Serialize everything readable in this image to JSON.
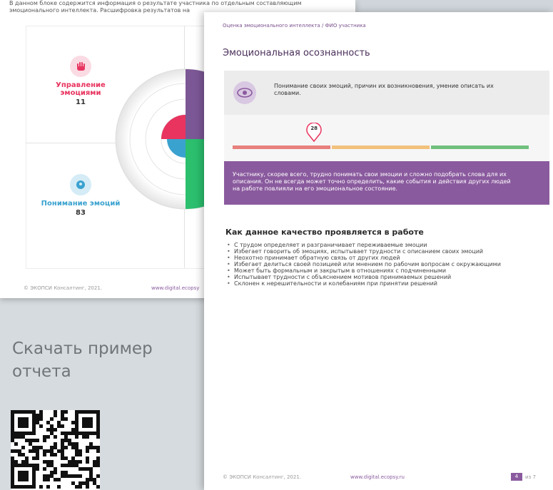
{
  "back_page": {
    "intro": "В данном блоке содержится информация о результате участника по отдельным составляющим эмоционального интеллекта. Расшифровка результатов на",
    "quadrants": [
      {
        "label": "Управление эмоциями",
        "value": "11",
        "color": "#e8345f"
      },
      {
        "label": "Понимание эмоций",
        "value": "83",
        "color": "#3aa2cf"
      }
    ],
    "footer_left": "© ЭКОПСИ Консалтинг, 2021.",
    "footer_url": "www.digital.ecopsy"
  },
  "front_page": {
    "breadcrumb": "Оценка эмоционального интеллекта / ФИО участника",
    "title": "Эмоциональная осознанность",
    "description": "Понимание своих эмоций, причин их возникновения, умение описать их словами.",
    "score": "28",
    "score_fraction": 0.28,
    "scale_colors": [
      "#e8807d",
      "#f2c27c",
      "#70c07c"
    ],
    "interpretation": "Участнику, скорее всего, трудно понимать свои эмоции и сложно подобрать слова для их описания. Он не всегда может точно определить, какие события и действия других людей на работе повлияли на его эмоциональное состояние.",
    "section_title": "Как данное качество проявляется в работе",
    "bullets": [
      "С трудом определяет и разграничивает переживаемые эмоции",
      "Избегает говорить об эмоциях, испытывает трудности с описанием своих эмоций",
      "Неохотно принимает обратную связь от других людей",
      "Избегает делиться своей позицией или мнением по рабочим вопросам с окружающими",
      "Может быть формальным и закрытым в отношениях с подчиненными",
      "Испытывает трудности с объяснением мотивов принимаемых решений",
      "Склонен к нерешительности и колебаниям при принятии решений"
    ],
    "footer_left": "© ЭКОПСИ Консалтинг, 2021.",
    "footer_url": "www.digital.ecopsy.ru",
    "page_number": "4",
    "page_total": "из 7"
  },
  "download": {
    "title": "Скачать пример отчета"
  },
  "colors": {
    "accent_purple": "#8a5a9e",
    "red": "#e8345f",
    "blue": "#3aa2cf",
    "green": "#2bbf6e"
  }
}
